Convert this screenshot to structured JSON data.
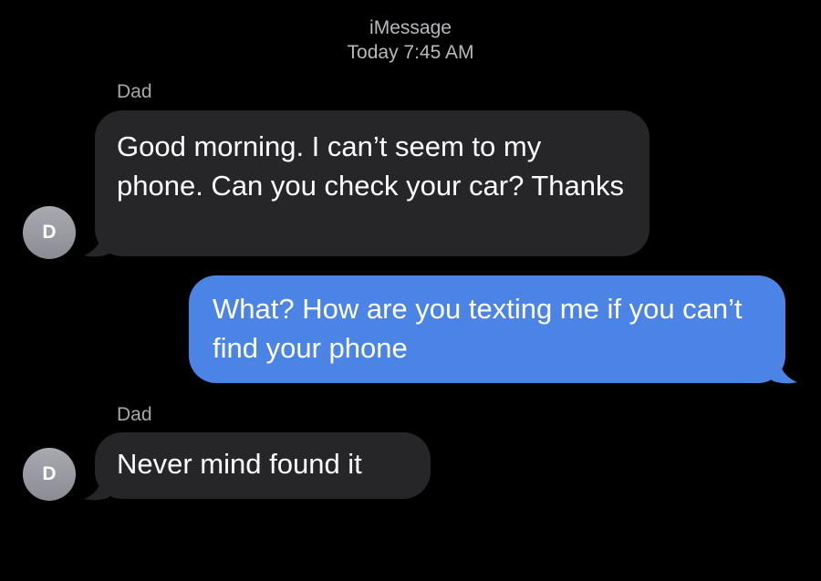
{
  "header": {
    "service": "iMessage",
    "timestamp": "Today 7:45 AM"
  },
  "messages": [
    {
      "sender": "Dad",
      "avatar_initial": "D",
      "text": "Good morning. I can’t seem to my phone. Can you check your car? Thanks",
      "direction": "received"
    },
    {
      "text": "What? How are you texting me if you can’t find your phone",
      "direction": "sent"
    },
    {
      "sender": "Dad",
      "avatar_initial": "D",
      "text": "Never mind found it",
      "direction": "received"
    }
  ],
  "colors": {
    "background": "#000000",
    "received_bubble": "#262629",
    "sent_bubble": "#4c84e6",
    "meta_text": "#a7a7ad"
  }
}
